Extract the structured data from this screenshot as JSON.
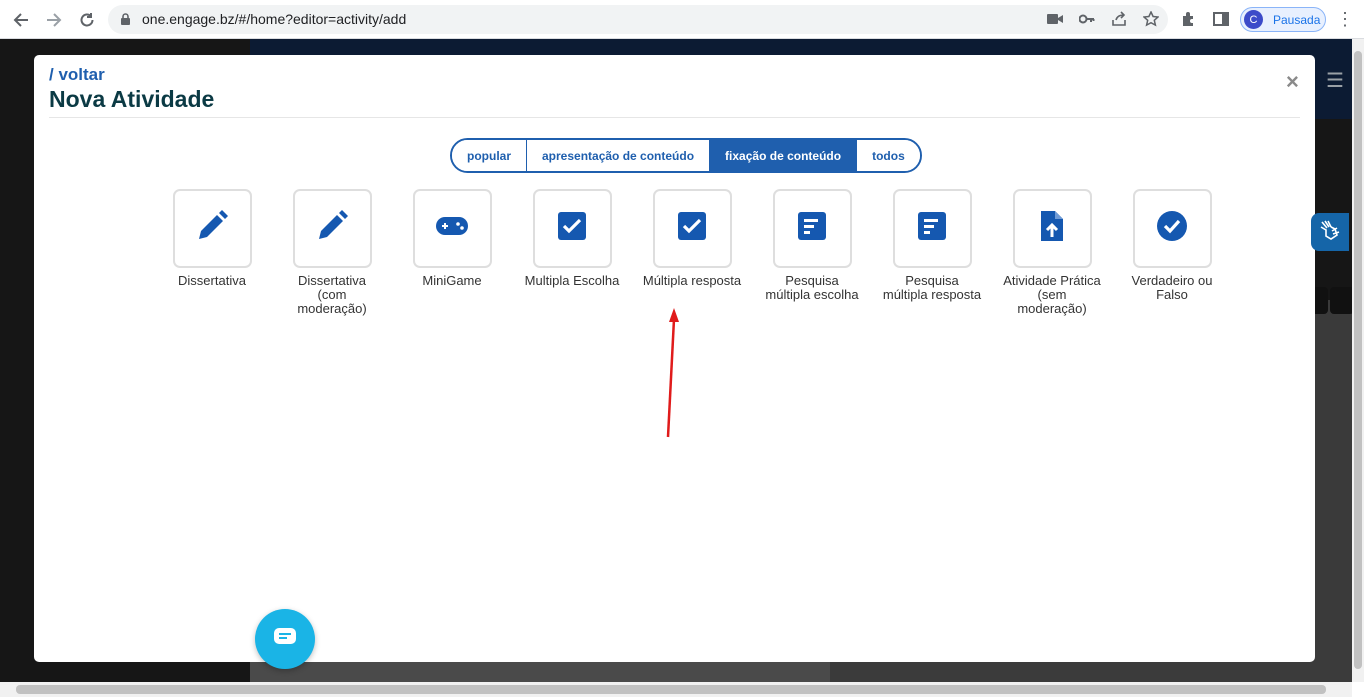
{
  "browser": {
    "url": "one.engage.bz/#/home?editor=activity/add",
    "profile_initial": "C",
    "profile_status": "Pausada"
  },
  "modal": {
    "back_link": "/ voltar",
    "title": "Nova Atividade",
    "close": "×"
  },
  "tabs": [
    {
      "label": "popular",
      "active": false
    },
    {
      "label": "apresentação de conteúdo",
      "active": false
    },
    {
      "label": "fixação de conteúdo",
      "active": true
    },
    {
      "label": "todos",
      "active": false
    }
  ],
  "cards": [
    {
      "label": "Dissertativa",
      "icon": "pencil-icon"
    },
    {
      "label": "Dissertativa (com moderação)",
      "icon": "pencil-icon"
    },
    {
      "label": "MiniGame",
      "icon": "gamepad-icon"
    },
    {
      "label": "Multipla Escolha",
      "icon": "checkbox-icon"
    },
    {
      "label": "Múltipla resposta",
      "icon": "checkbox-icon"
    },
    {
      "label": "Pesquisa múltipla escolha",
      "icon": "list-icon"
    },
    {
      "label": "Pesquisa múltipla resposta",
      "icon": "list-icon"
    },
    {
      "label": "Atividade Prática (sem moderação)",
      "icon": "file-upload-icon"
    },
    {
      "label": "Verdadeiro ou Falso",
      "icon": "check-circle-icon"
    }
  ],
  "colors": {
    "accent": "#1f5fae",
    "icon_blue": "#1558b0",
    "chat": "#1ab4e6",
    "arrow": "#e01b1b"
  }
}
